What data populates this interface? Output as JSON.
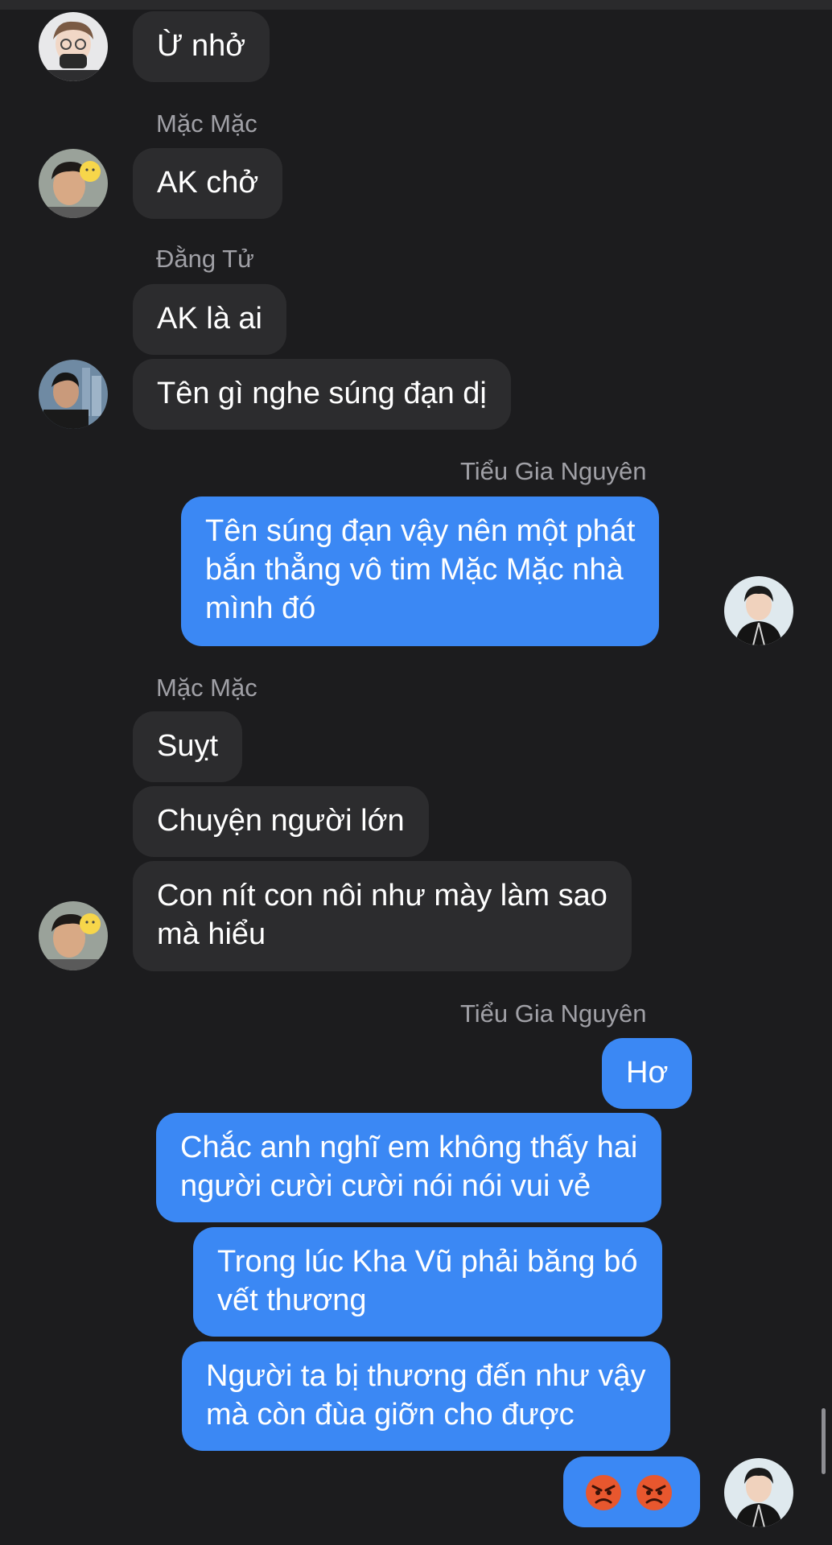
{
  "senders": {
    "s1": "Mặc Mặc",
    "s2": "Đằng Tử",
    "s3": "Tiểu Gia Nguyên",
    "s4": "Mặc Mặc",
    "s5": "Tiểu Gia Nguyên"
  },
  "messages": {
    "m1": "Ừ nhở",
    "m2": "AK chở",
    "m3": "AK là ai",
    "m4": "Tên gì nghe súng đạn dị",
    "m5_l1": "Tên súng đạn vậy nên một phát",
    "m5_l2": "bắn thẳng vô tim Mặc Mặc nhà",
    "m5_l3": "mình đó",
    "m6": "Suỵt",
    "m7": "Chuyện người lớn",
    "m8_l1": "Con nít con nôi như mày làm sao",
    "m8_l2": "mà hiểu",
    "m9": "Hơ",
    "m10_l1": "Chắc anh nghĩ em không thấy hai",
    "m10_l2": "người cười cười nói nói vui vẻ",
    "m11_l1": "Trong lúc Kha Vũ phải băng bó",
    "m11_l2": "vết thương",
    "m12_l1": "Người ta bị thương đến như vậy",
    "m12_l2": "mà còn đùa giỡn cho được",
    "m13_emojis": [
      "angry-face",
      "angry-face"
    ]
  },
  "colors": {
    "background": "#1c1c1e",
    "incoming_bubble": "#2c2c2e",
    "outgoing_bubble": "#3b88f4",
    "sender_name": "#a0a0a6"
  }
}
